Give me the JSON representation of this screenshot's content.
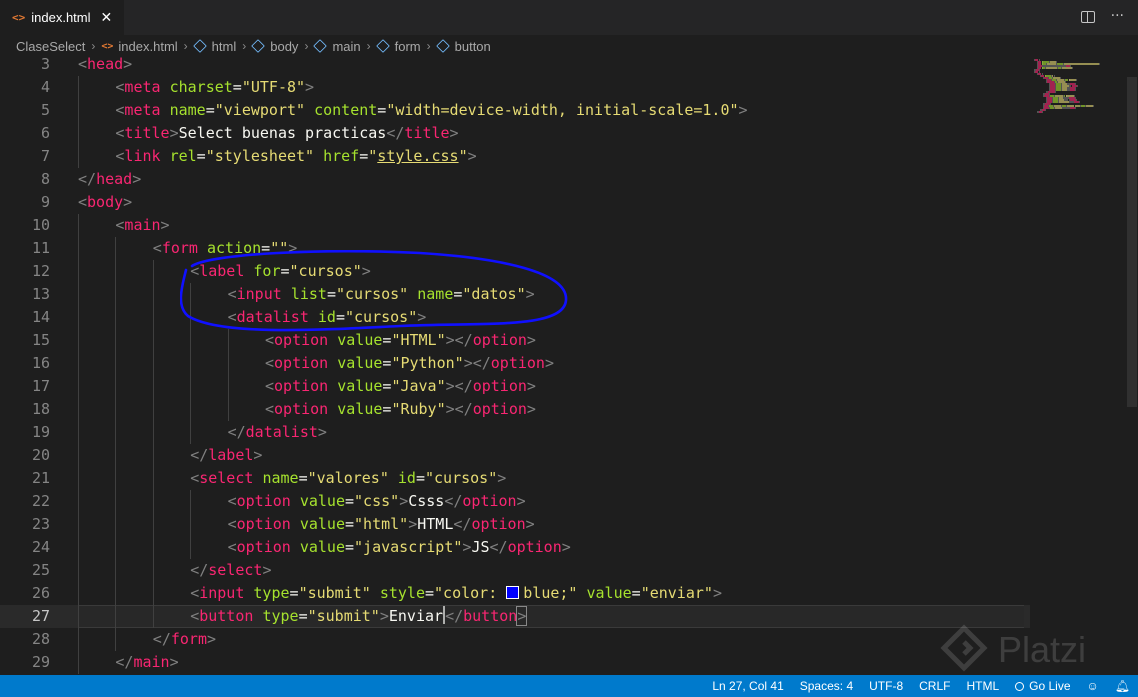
{
  "tab": {
    "icon": "<>",
    "label": "index.html",
    "close": "✕"
  },
  "breadcrumb": [
    {
      "label": "ClaseSelect",
      "icon": ""
    },
    {
      "label": "index.html",
      "icon": "html-file-icon"
    },
    {
      "label": "html",
      "icon": "cube-icon"
    },
    {
      "label": "body",
      "icon": "cube-icon"
    },
    {
      "label": "main",
      "icon": "cube-icon"
    },
    {
      "label": "form",
      "icon": "cube-icon"
    },
    {
      "label": "button",
      "icon": "cube-icon"
    }
  ],
  "editor": {
    "current_line": 27,
    "lines": [
      {
        "n": "3",
        "indent": 0,
        "tokens": [
          [
            "t",
            "<"
          ],
          [
            "tg",
            "head"
          ],
          [
            "t",
            ">"
          ]
        ]
      },
      {
        "n": "4",
        "indent": 1,
        "tokens": [
          [
            "t",
            "<"
          ],
          [
            "tg",
            "meta"
          ],
          [
            "tx",
            " "
          ],
          [
            "at",
            "charset"
          ],
          [
            "tx",
            "="
          ],
          [
            "st",
            "\"UTF-8\""
          ],
          [
            "t",
            ">"
          ]
        ]
      },
      {
        "n": "5",
        "indent": 1,
        "tokens": [
          [
            "t",
            "<"
          ],
          [
            "tg",
            "meta"
          ],
          [
            "tx",
            " "
          ],
          [
            "at",
            "name"
          ],
          [
            "tx",
            "="
          ],
          [
            "st",
            "\"viewport\""
          ],
          [
            "tx",
            " "
          ],
          [
            "at",
            "content"
          ],
          [
            "tx",
            "="
          ],
          [
            "st",
            "\"width=device-width, initial-scale=1.0\""
          ],
          [
            "t",
            ">"
          ]
        ]
      },
      {
        "n": "6",
        "indent": 1,
        "tokens": [
          [
            "t",
            "<"
          ],
          [
            "tg",
            "title"
          ],
          [
            "t",
            ">"
          ],
          [
            "tx",
            "Select buenas practicas"
          ],
          [
            "t",
            "</"
          ],
          [
            "tg",
            "title"
          ],
          [
            "t",
            ">"
          ]
        ]
      },
      {
        "n": "7",
        "indent": 1,
        "tokens": [
          [
            "t",
            "<"
          ],
          [
            "tg",
            "link"
          ],
          [
            "tx",
            " "
          ],
          [
            "at",
            "rel"
          ],
          [
            "tx",
            "="
          ],
          [
            "st",
            "\"stylesheet\""
          ],
          [
            "tx",
            " "
          ],
          [
            "at",
            "href"
          ],
          [
            "tx",
            "="
          ],
          [
            "st",
            "\""
          ],
          [
            "stu",
            "style.css"
          ],
          [
            "st",
            "\""
          ],
          [
            "t",
            ">"
          ]
        ]
      },
      {
        "n": "8",
        "indent": 0,
        "tokens": [
          [
            "t",
            "</"
          ],
          [
            "tg",
            "head"
          ],
          [
            "t",
            ">"
          ]
        ]
      },
      {
        "n": "9",
        "indent": 0,
        "tokens": [
          [
            "t",
            "<"
          ],
          [
            "tg",
            "body"
          ],
          [
            "t",
            ">"
          ]
        ]
      },
      {
        "n": "10",
        "indent": 1,
        "tokens": [
          [
            "t",
            "<"
          ],
          [
            "tg",
            "main"
          ],
          [
            "t",
            ">"
          ]
        ]
      },
      {
        "n": "11",
        "indent": 2,
        "tokens": [
          [
            "t",
            "<"
          ],
          [
            "tg",
            "form"
          ],
          [
            "tx",
            " "
          ],
          [
            "at",
            "action"
          ],
          [
            "tx",
            "="
          ],
          [
            "st",
            "\"\""
          ],
          [
            "t",
            ">"
          ]
        ]
      },
      {
        "n": "12",
        "indent": 3,
        "tokens": [
          [
            "t",
            "<"
          ],
          [
            "tg",
            "label"
          ],
          [
            "tx",
            " "
          ],
          [
            "at",
            "for"
          ],
          [
            "tx",
            "="
          ],
          [
            "st",
            "\"cursos\""
          ],
          [
            "t",
            ">"
          ]
        ]
      },
      {
        "n": "13",
        "indent": 4,
        "tokens": [
          [
            "t",
            "<"
          ],
          [
            "tg",
            "input"
          ],
          [
            "tx",
            " "
          ],
          [
            "at",
            "list"
          ],
          [
            "tx",
            "="
          ],
          [
            "st",
            "\"cursos\""
          ],
          [
            "tx",
            " "
          ],
          [
            "at",
            "name"
          ],
          [
            "tx",
            "="
          ],
          [
            "st",
            "\"datos\""
          ],
          [
            "t",
            ">"
          ]
        ]
      },
      {
        "n": "14",
        "indent": 4,
        "tokens": [
          [
            "t",
            "<"
          ],
          [
            "tg",
            "datalist"
          ],
          [
            "tx",
            " "
          ],
          [
            "at",
            "id"
          ],
          [
            "tx",
            "="
          ],
          [
            "st",
            "\"cursos\""
          ],
          [
            "t",
            ">"
          ]
        ]
      },
      {
        "n": "15",
        "indent": 5,
        "tokens": [
          [
            "t",
            "<"
          ],
          [
            "tg",
            "option"
          ],
          [
            "tx",
            " "
          ],
          [
            "at",
            "value"
          ],
          [
            "tx",
            "="
          ],
          [
            "st",
            "\"HTML\""
          ],
          [
            "t",
            ">"
          ],
          [
            "t",
            "</"
          ],
          [
            "tg",
            "option"
          ],
          [
            "t",
            ">"
          ]
        ]
      },
      {
        "n": "16",
        "indent": 5,
        "tokens": [
          [
            "t",
            "<"
          ],
          [
            "tg",
            "option"
          ],
          [
            "tx",
            " "
          ],
          [
            "at",
            "value"
          ],
          [
            "tx",
            "="
          ],
          [
            "st",
            "\"Python\""
          ],
          [
            "t",
            ">"
          ],
          [
            "t",
            "</"
          ],
          [
            "tg",
            "option"
          ],
          [
            "t",
            ">"
          ]
        ]
      },
      {
        "n": "17",
        "indent": 5,
        "tokens": [
          [
            "t",
            "<"
          ],
          [
            "tg",
            "option"
          ],
          [
            "tx",
            " "
          ],
          [
            "at",
            "value"
          ],
          [
            "tx",
            "="
          ],
          [
            "st",
            "\"Java\""
          ],
          [
            "t",
            ">"
          ],
          [
            "t",
            "</"
          ],
          [
            "tg",
            "option"
          ],
          [
            "t",
            ">"
          ]
        ]
      },
      {
        "n": "18",
        "indent": 5,
        "tokens": [
          [
            "t",
            "<"
          ],
          [
            "tg",
            "option"
          ],
          [
            "tx",
            " "
          ],
          [
            "at",
            "value"
          ],
          [
            "tx",
            "="
          ],
          [
            "st",
            "\"Ruby\""
          ],
          [
            "t",
            ">"
          ],
          [
            "t",
            "</"
          ],
          [
            "tg",
            "option"
          ],
          [
            "t",
            ">"
          ]
        ]
      },
      {
        "n": "19",
        "indent": 4,
        "tokens": [
          [
            "t",
            "</"
          ],
          [
            "tg",
            "datalist"
          ],
          [
            "t",
            ">"
          ]
        ]
      },
      {
        "n": "20",
        "indent": 3,
        "tokens": [
          [
            "t",
            "</"
          ],
          [
            "tg",
            "label"
          ],
          [
            "t",
            ">"
          ]
        ]
      },
      {
        "n": "21",
        "indent": 3,
        "tokens": [
          [
            "t",
            "<"
          ],
          [
            "tg",
            "select"
          ],
          [
            "tx",
            " "
          ],
          [
            "at",
            "name"
          ],
          [
            "tx",
            "="
          ],
          [
            "st",
            "\"valores\""
          ],
          [
            "tx",
            " "
          ],
          [
            "at",
            "id"
          ],
          [
            "tx",
            "="
          ],
          [
            "st",
            "\"cursos\""
          ],
          [
            "t",
            ">"
          ]
        ]
      },
      {
        "n": "22",
        "indent": 4,
        "tokens": [
          [
            "t",
            "<"
          ],
          [
            "tg",
            "option"
          ],
          [
            "tx",
            " "
          ],
          [
            "at",
            "value"
          ],
          [
            "tx",
            "="
          ],
          [
            "st",
            "\"css\""
          ],
          [
            "t",
            ">"
          ],
          [
            "tx",
            "Csss"
          ],
          [
            "t",
            "</"
          ],
          [
            "tg",
            "option"
          ],
          [
            "t",
            ">"
          ]
        ]
      },
      {
        "n": "23",
        "indent": 4,
        "tokens": [
          [
            "t",
            "<"
          ],
          [
            "tg",
            "option"
          ],
          [
            "tx",
            " "
          ],
          [
            "at",
            "value"
          ],
          [
            "tx",
            "="
          ],
          [
            "st",
            "\"html\""
          ],
          [
            "t",
            ">"
          ],
          [
            "tx",
            "HTML"
          ],
          [
            "t",
            "</"
          ],
          [
            "tg",
            "option"
          ],
          [
            "t",
            ">"
          ]
        ]
      },
      {
        "n": "24",
        "indent": 4,
        "tokens": [
          [
            "t",
            "<"
          ],
          [
            "tg",
            "option"
          ],
          [
            "tx",
            " "
          ],
          [
            "at",
            "value"
          ],
          [
            "tx",
            "="
          ],
          [
            "st",
            "\"javascript\""
          ],
          [
            "t",
            ">"
          ],
          [
            "tx",
            "JS"
          ],
          [
            "t",
            "</"
          ],
          [
            "tg",
            "option"
          ],
          [
            "t",
            ">"
          ]
        ]
      },
      {
        "n": "25",
        "indent": 3,
        "tokens": [
          [
            "t",
            "</"
          ],
          [
            "tg",
            "select"
          ],
          [
            "t",
            ">"
          ]
        ]
      },
      {
        "n": "26",
        "indent": 3,
        "tokens": [
          [
            "t",
            "<"
          ],
          [
            "tg",
            "input"
          ],
          [
            "tx",
            " "
          ],
          [
            "at",
            "type"
          ],
          [
            "tx",
            "="
          ],
          [
            "st",
            "\"submit\""
          ],
          [
            "tx",
            " "
          ],
          [
            "at",
            "style"
          ],
          [
            "tx",
            "="
          ],
          [
            "st",
            "\"color: "
          ],
          [
            "sw",
            ""
          ],
          [
            "st",
            "blue;\""
          ],
          [
            "tx",
            " "
          ],
          [
            "at",
            "value"
          ],
          [
            "tx",
            "="
          ],
          [
            "st",
            "\"enviar\""
          ],
          [
            "t",
            ">"
          ]
        ]
      },
      {
        "n": "27",
        "indent": 3,
        "tokens": [
          [
            "t",
            "<"
          ],
          [
            "tg",
            "button"
          ],
          [
            "tx",
            " "
          ],
          [
            "at",
            "type"
          ],
          [
            "tx",
            "="
          ],
          [
            "st",
            "\"submit\""
          ],
          [
            "t",
            ">"
          ],
          [
            "tx",
            "Enviar"
          ],
          [
            "cur",
            ""
          ],
          [
            "t",
            "</"
          ],
          [
            "tg",
            "button"
          ],
          [
            "tb",
            ">"
          ]
        ]
      },
      {
        "n": "28",
        "indent": 2,
        "tokens": [
          [
            "t",
            "</"
          ],
          [
            "tg",
            "form"
          ],
          [
            "t",
            ">"
          ]
        ]
      },
      {
        "n": "29",
        "indent": 1,
        "tokens": [
          [
            "t",
            "</"
          ],
          [
            "tg",
            "main"
          ],
          [
            "t",
            ">"
          ]
        ]
      }
    ]
  },
  "colors": {
    "tag": "#f92672",
    "attribute": "#a6e22e",
    "string": "#e6db74",
    "text": "#f8f8f2",
    "bracket": "#808080",
    "statusbar": "#007acc",
    "annotation": "#1010ff"
  },
  "statusbar": {
    "position": "Ln 27, Col 41",
    "spaces": "Spaces: 4",
    "encoding": "UTF-8",
    "eol": "CRLF",
    "language": "HTML",
    "golive": "Go Live"
  },
  "watermark": {
    "text": "Platzi"
  }
}
